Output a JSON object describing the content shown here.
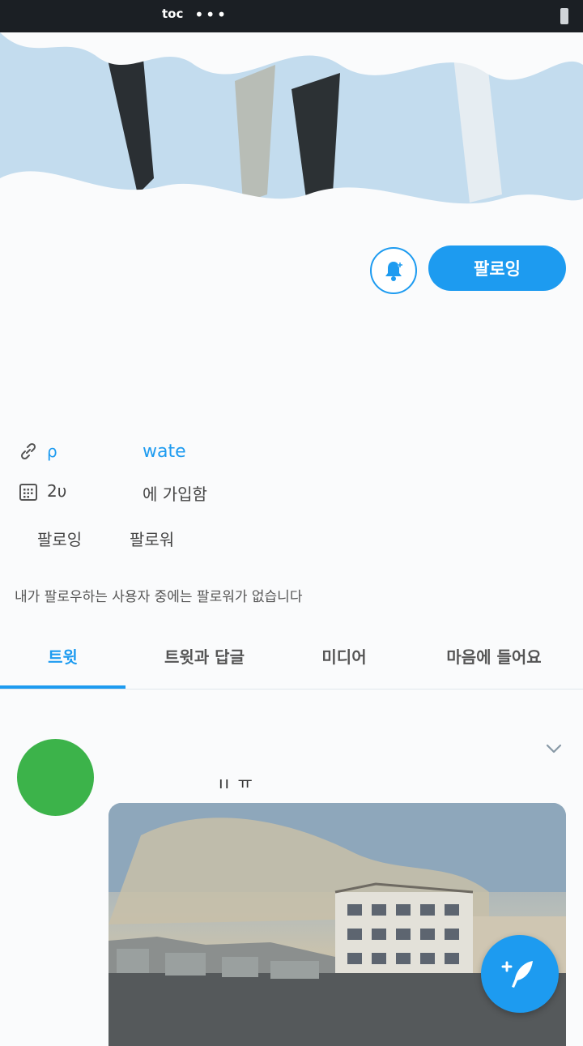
{
  "status_bar": {
    "text": "toc",
    "more": "•••"
  },
  "profile": {
    "follow_button_label": "팔로잉",
    "website_prefix": "ρ",
    "website_link": "wate",
    "join_prefix": "2υ",
    "join_text": "에 가입함",
    "following_label": "팔로잉",
    "followers_label": "팔로워",
    "mutuals_note": "내가 팔로우하는 사용자 중에는 팔로워가 없습니다"
  },
  "tabs": [
    {
      "label": "트윗",
      "active": true
    },
    {
      "label": "트윗과 답글",
      "active": false
    },
    {
      "label": "미디어",
      "active": false
    },
    {
      "label": "마음에 들어요",
      "active": false
    }
  ],
  "tweet": {
    "text": "ıı ㅠ"
  },
  "colors": {
    "accent": "#1d9bf0",
    "avatar": "#3cb34a"
  }
}
